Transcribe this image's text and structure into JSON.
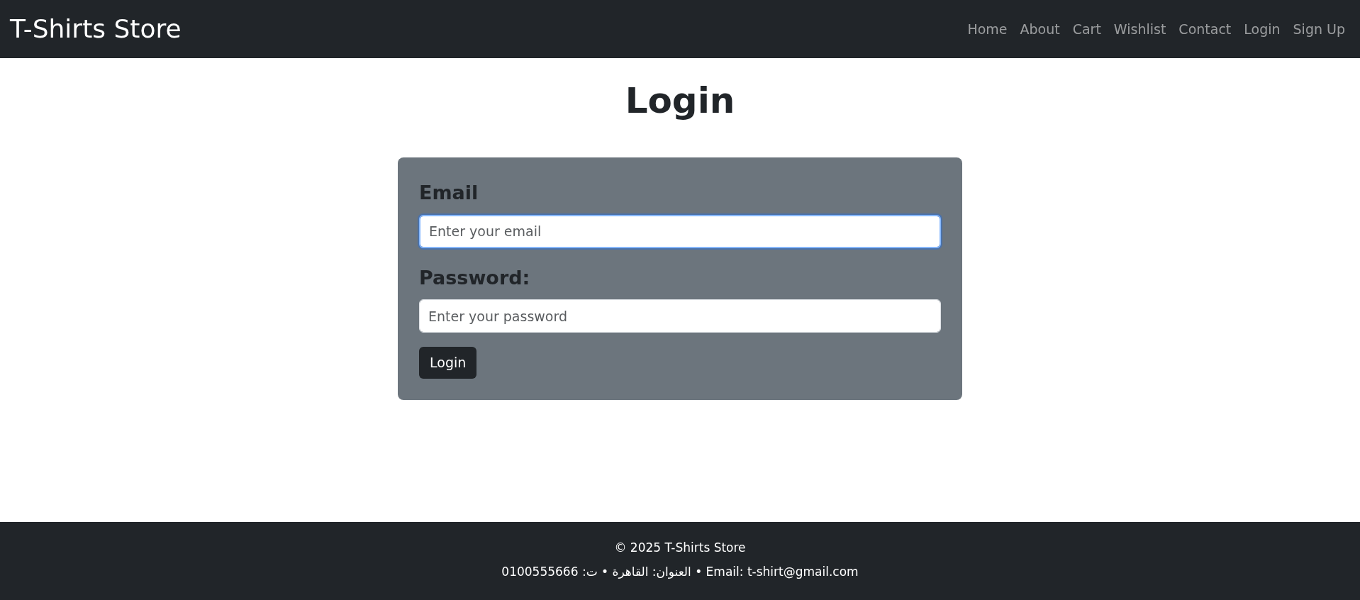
{
  "navbar": {
    "brand": "T-Shirts Store",
    "links": [
      {
        "label": "Home",
        "selected": false
      },
      {
        "label": "About",
        "selected": false
      },
      {
        "label": "Cart",
        "selected": false
      },
      {
        "label": "Wishlist",
        "selected": false
      },
      {
        "label": "Contact",
        "selected": false
      },
      {
        "label": "Login",
        "selected": false
      },
      {
        "label": "Sign Up",
        "selected": false
      }
    ]
  },
  "page_title": "Login",
  "form": {
    "fields": [
      {
        "label": "Email",
        "placeholder": "Enter your email",
        "focused": true
      },
      {
        "label": "Password:",
        "placeholder": "Enter your password",
        "focused": false
      }
    ],
    "submit": "Login"
  },
  "footer": {
    "copyright": "© 2025 T-Shirts Store",
    "contact": "Email: t-shirt@gmail.com • العنوان: القاهرة • ت: 0100555666"
  }
}
